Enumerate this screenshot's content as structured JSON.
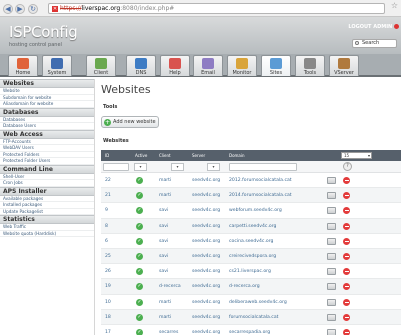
{
  "browser": {
    "url_https": "https://",
    "url_host": "liverspac.org",
    "url_rest": ":8080/index.php#"
  },
  "header": {
    "logo": "ISPConfig",
    "subtitle": "hosting control panel",
    "logout": "LOGOUT ADMIN",
    "search_placeholder": "Search"
  },
  "tabs": [
    {
      "label": "Home",
      "color": "#e0633a"
    },
    {
      "label": "System",
      "color": "#3f6cb0"
    },
    {
      "label": "Client",
      "color": "#6aa84f"
    },
    {
      "label": "DNS",
      "color": "#3e7cc4"
    },
    {
      "label": "Help",
      "color": "#d9534f"
    },
    {
      "label": "Email",
      "color": "#8e7cc3"
    },
    {
      "label": "Monitor",
      "color": "#d9a43a"
    },
    {
      "label": "Sites",
      "color": "#5b9bd5"
    },
    {
      "label": "Tools",
      "color": "#888888"
    },
    {
      "label": "VServer",
      "color": "#b07a3e"
    }
  ],
  "sidebar": {
    "sections": [
      {
        "title": "Websites",
        "items": [
          "Website",
          "Subdomain for website",
          "Aliasdomain for website"
        ]
      },
      {
        "title": "Databases",
        "items": [
          "Databases",
          "Database Users"
        ]
      },
      {
        "title": "Web Access",
        "items": [
          "FTP-Accounts",
          "WebDAV Users",
          "Protected Folders",
          "Protected Folder Users"
        ]
      },
      {
        "title": "Command Line",
        "items": [
          "Shell-User",
          "Cron Jobs"
        ]
      },
      {
        "title": "APS Installer",
        "items": [
          "Available packages",
          "Installed packages",
          "Update Packagelist"
        ]
      },
      {
        "title": "Statistics",
        "items": [
          "Web Traffic",
          "Website quota (Harddisk)"
        ]
      }
    ]
  },
  "main": {
    "title": "Websites",
    "tools_label": "Tools",
    "add_button": "Add new website",
    "list_label": "Websites",
    "columns": {
      "id": "ID",
      "active": "Active",
      "client": "Client",
      "server": "Server",
      "domain": "Domain"
    },
    "per_page": "15",
    "filter_select": "▾"
  },
  "rows": [
    {
      "id": "22",
      "client": "marti",
      "server": "seedv4c.org",
      "domain": "2012.forumsocialcatala.cat"
    },
    {
      "id": "21",
      "client": "marti",
      "server": "seedv4c.org",
      "domain": "2014.forumsocialcatala.cat"
    },
    {
      "id": "9",
      "client": "savi",
      "server": "seedv4c.org",
      "domain": "webforum.seedv4c.org"
    },
    {
      "id": "8",
      "client": "savi",
      "server": "seedv4c.org",
      "domain": "carpetti.seedv4c.org"
    },
    {
      "id": "6",
      "client": "savi",
      "server": "seedv4c.org",
      "domain": "cocina.seedv4c.org"
    },
    {
      "id": "25",
      "client": "savi",
      "server": "seedv4c.org",
      "domain": "creirecivedspora.org"
    },
    {
      "id": "26",
      "client": "savi",
      "server": "seedv4c.org",
      "domain": "cs21.liverspac.org"
    },
    {
      "id": "19",
      "client": "d-recerca",
      "server": "seedv4c.org",
      "domain": "d-recerca.org"
    },
    {
      "id": "10",
      "client": "marti",
      "server": "seedv4c.org",
      "domain": "deliberaweb.seedv4c.org"
    },
    {
      "id": "18",
      "client": "marti",
      "server": "seedv4c.org",
      "domain": "forumsocialcatala.cat"
    },
    {
      "id": "17",
      "client": "secarres",
      "server": "seedv4c.org",
      "domain": "secarrespadia.org"
    }
  ]
}
